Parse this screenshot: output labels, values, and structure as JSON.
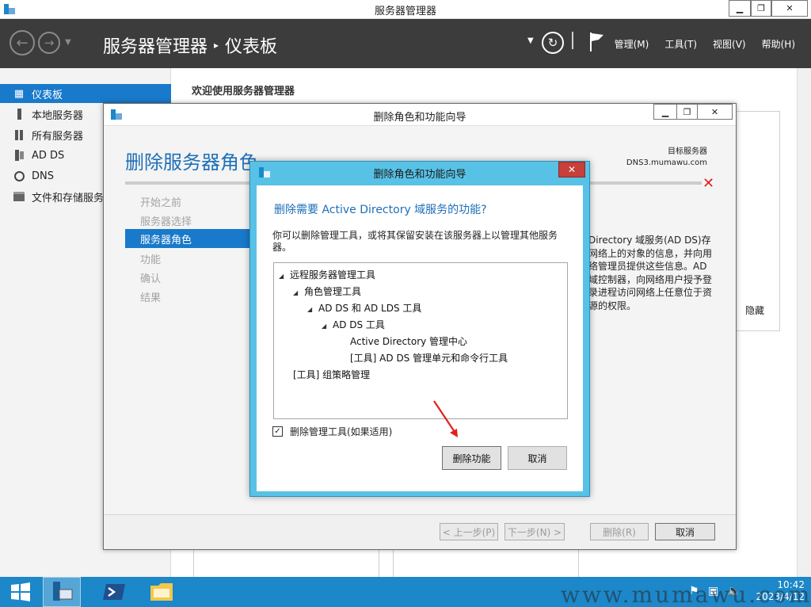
{
  "window": {
    "title": "服务器管理器",
    "minimize": "▁",
    "restore": "❐",
    "close": "✕"
  },
  "header": {
    "breadcrumb_root": "服务器管理器",
    "breadcrumb_sep": "▸",
    "breadcrumb_page": "仪表板",
    "menu": [
      "管理(M)",
      "工具(T)",
      "视图(V)",
      "帮助(H)"
    ]
  },
  "sidebar": {
    "items": [
      {
        "label": "仪表板",
        "icon": "dashboard-icon"
      },
      {
        "label": "本地服务器",
        "icon": "server-icon"
      },
      {
        "label": "所有服务器",
        "icon": "servers-icon"
      },
      {
        "label": "AD DS",
        "icon": "ad-ds-icon"
      },
      {
        "label": "DNS",
        "icon": "dns-icon"
      },
      {
        "label": "文件和存储服务",
        "icon": "storage-icon"
      }
    ]
  },
  "dashboard": {
    "welcome": "欢迎使用服务器管理器",
    "hide_label": "隐藏"
  },
  "wizard": {
    "title": "删除角色和功能向导",
    "heading": "删除服务器角色",
    "target_label": "目标服务器",
    "target_server": "DNS3.mumawu.com",
    "steps": [
      "开始之前",
      "服务器选择",
      "服务器角色",
      "功能",
      "确认",
      "结果"
    ],
    "active_step": 2,
    "body_text": "Directory 域服务(AD DS)存网络上的对象的信息，并向用络管理员提供这些信息。AD域控制器，向网络用户授予登录进程访问网络上任意位于资源的权限。",
    "buttons": {
      "prev": "< 上一步(P)",
      "next": "下一步(N) >",
      "remove": "删除(R)",
      "cancel": "取消"
    }
  },
  "dialog": {
    "title": "删除角色和功能向导",
    "close": "✕",
    "heading": "删除需要 Active Directory 域服务的功能?",
    "description": "你可以删除管理工具，或将其保留安装在该服务器上以管理其他服务器。",
    "tree": [
      {
        "label": "远程服务器管理工具",
        "level": 0,
        "expanded": true
      },
      {
        "label": "角色管理工具",
        "level": 1,
        "expanded": true
      },
      {
        "label": "AD DS 和 AD LDS 工具",
        "level": 2,
        "expanded": true
      },
      {
        "label": "AD DS 工具",
        "level": 3,
        "expanded": true
      },
      {
        "label": "Active Directory 管理中心",
        "level": 4,
        "expanded": false
      },
      {
        "label": "[工具] AD DS 管理单元和命令行工具",
        "level": 4,
        "expanded": false
      },
      {
        "label": "[工具] 组策略管理",
        "level": 0,
        "expanded": false
      }
    ],
    "checkbox_label": "删除管理工具(如果适用)",
    "checkbox_checked": true,
    "buttons": {
      "remove_features": "删除功能",
      "cancel": "取消"
    }
  },
  "taskbar": {
    "time": "10:42",
    "date": "2023/4/12"
  },
  "watermark": "www.mumawu.com",
  "colors": {
    "accent": "#1979ca",
    "dialog_frame": "#58c2e6",
    "taskbar": "#1c87c9",
    "header": "#3c3c3c",
    "error": "#e0201b"
  }
}
